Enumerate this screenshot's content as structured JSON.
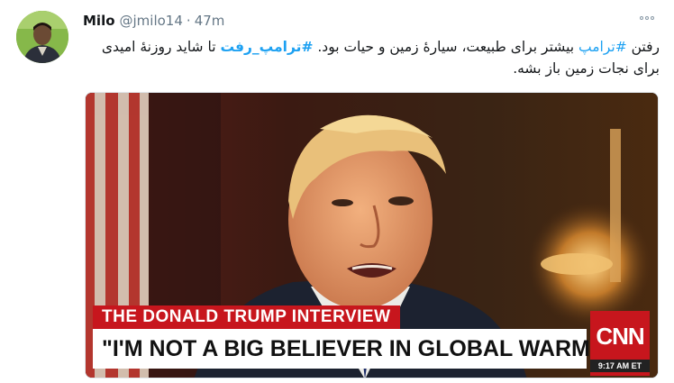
{
  "tweet": {
    "display_name": "Milo",
    "handle": "@jmilo14",
    "separator": "·",
    "timestamp": "47m",
    "more_icon": "more-horizontal-icon",
    "text": {
      "part1": "رفتن ",
      "hashtag1": "#ترامپ",
      "part2": " بیشتر برای طبیعت، سیارهٔ زمین و حیات بود. ",
      "hashtag2": "#ترامپ_رفت",
      "part3": " تا شاید روزنهٔ امیدی برای نجات زمین باز بشه."
    },
    "colors": {
      "link": "#1da1f2",
      "secondary_text": "#657786",
      "cnn_red": "#c7161d"
    }
  },
  "media": {
    "headline": "THE DONALD TRUMP INTERVIEW",
    "quote": "\"I'M NOT A BIG BELIEVER IN GLOBAL WARMING\"",
    "network_logo": "CNN",
    "clock": "9:17 AM ET"
  }
}
